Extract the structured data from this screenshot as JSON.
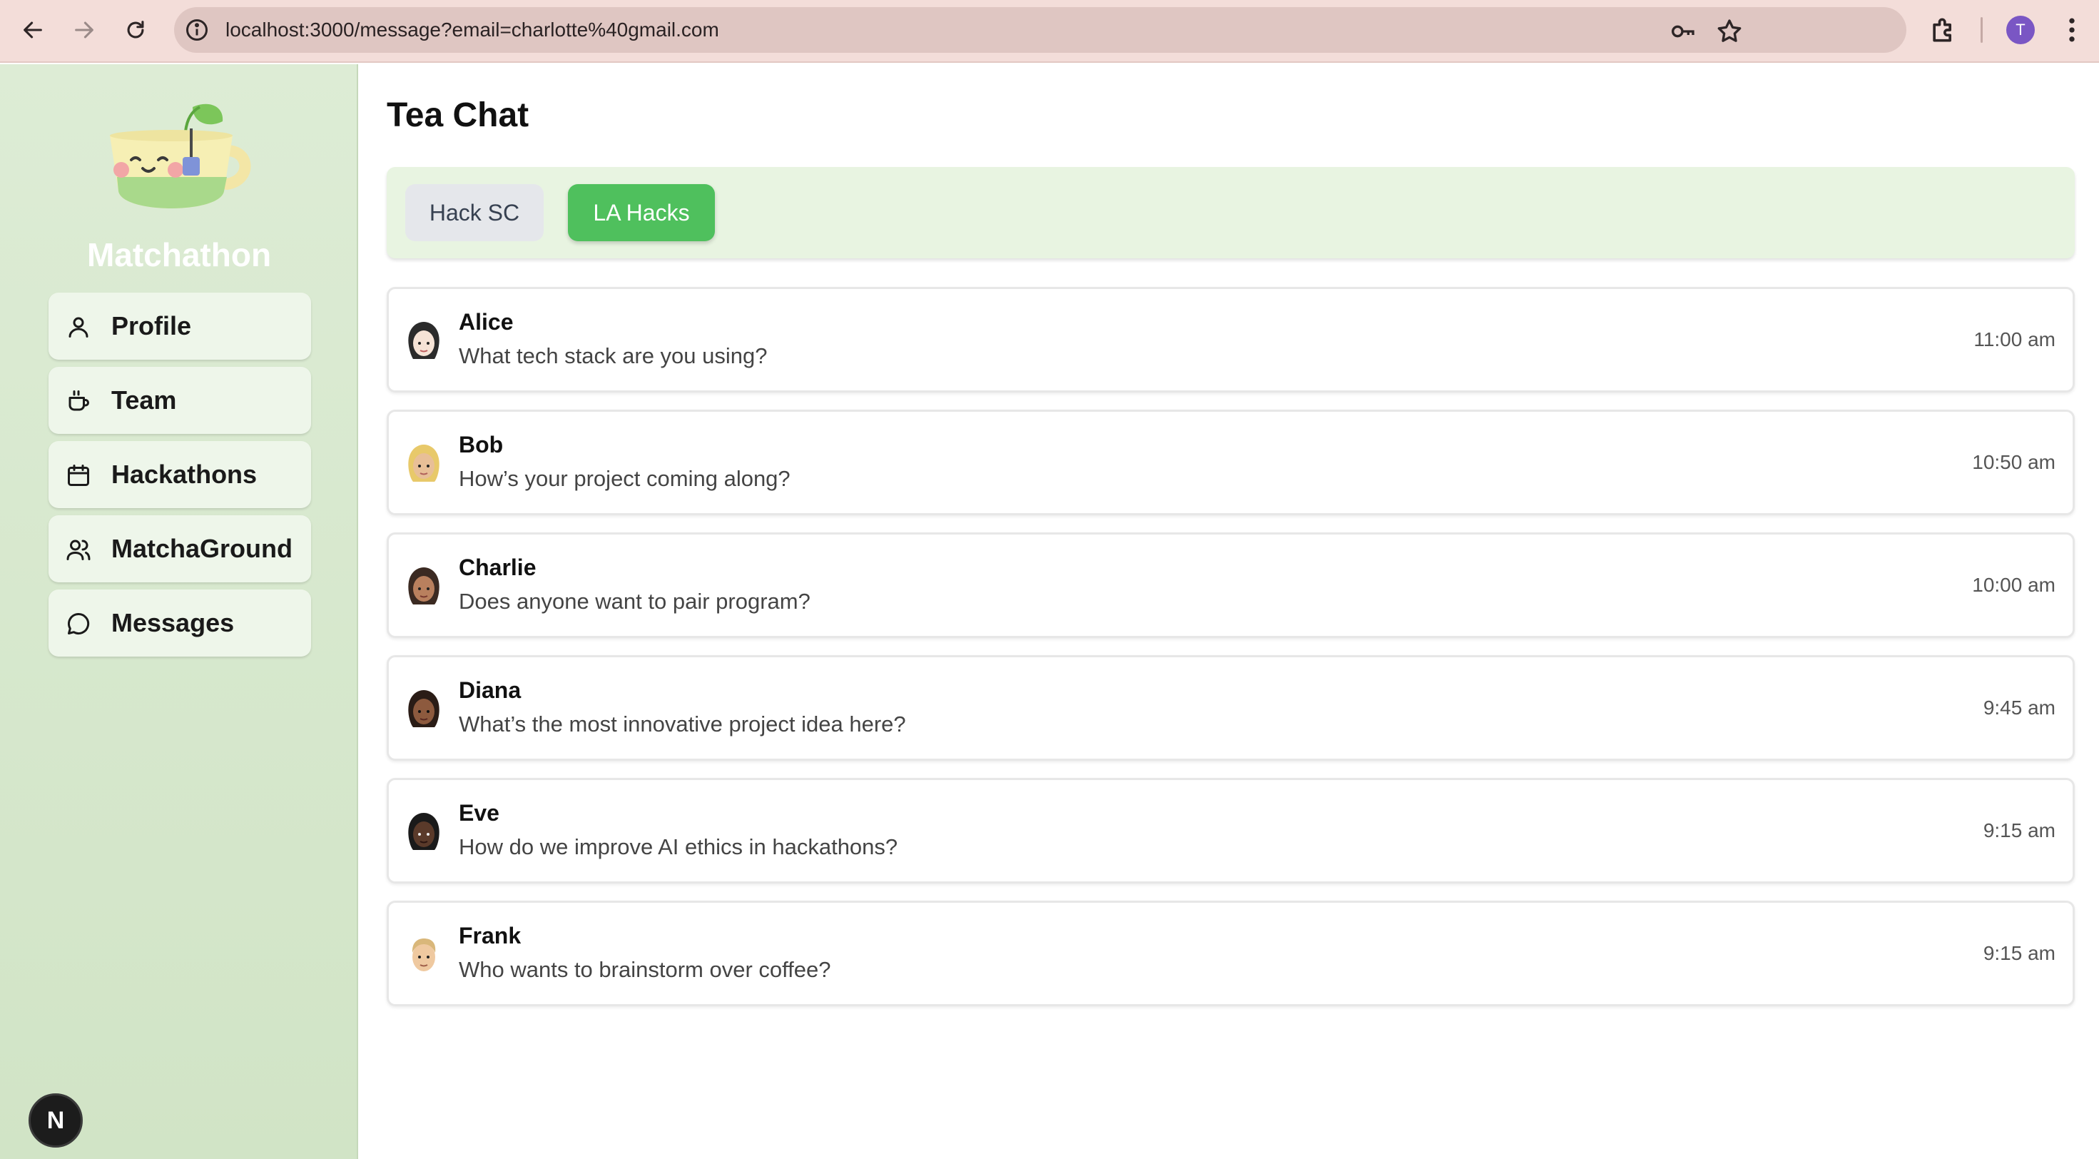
{
  "browser": {
    "url": "localhost:3000/message?email=charlotte%40gmail.com",
    "profile_initial": "T"
  },
  "sidebar": {
    "brand": "Matchathon",
    "items": [
      {
        "label": "Profile",
        "icon": "user-icon"
      },
      {
        "label": "Team",
        "icon": "cup-icon"
      },
      {
        "label": "Hackathons",
        "icon": "calendar-icon"
      },
      {
        "label": "MatchaGround",
        "icon": "users-icon"
      },
      {
        "label": "Messages",
        "icon": "chat-bubble-icon"
      }
    ],
    "dev_badge": "N"
  },
  "main": {
    "title": "Tea Chat",
    "tabs": [
      {
        "label": "Hack SC",
        "active": false
      },
      {
        "label": "LA Hacks",
        "active": true
      }
    ],
    "chats": [
      {
        "name": "Alice",
        "message": "What tech stack are you using?",
        "time": "11:00 am"
      },
      {
        "name": "Bob",
        "message": "How’s your project coming along?",
        "time": "10:50 am"
      },
      {
        "name": "Charlie",
        "message": "Does anyone want to pair program?",
        "time": "10:00 am"
      },
      {
        "name": "Diana",
        "message": "What’s the most innovative project idea here?",
        "time": "9:45 am"
      },
      {
        "name": "Eve",
        "message": "How do we improve AI ethics in hackathons?",
        "time": "9:15 am"
      },
      {
        "name": "Frank",
        "message": "Who wants to brainstorm over coffee?",
        "time": "9:15 am"
      }
    ]
  },
  "colors": {
    "sidebar_bg": "#d9eacf",
    "active_tab": "#4fc05d",
    "tabs_bar_bg": "#e8f4e1",
    "chrome_bg": "#f3ddd9"
  }
}
